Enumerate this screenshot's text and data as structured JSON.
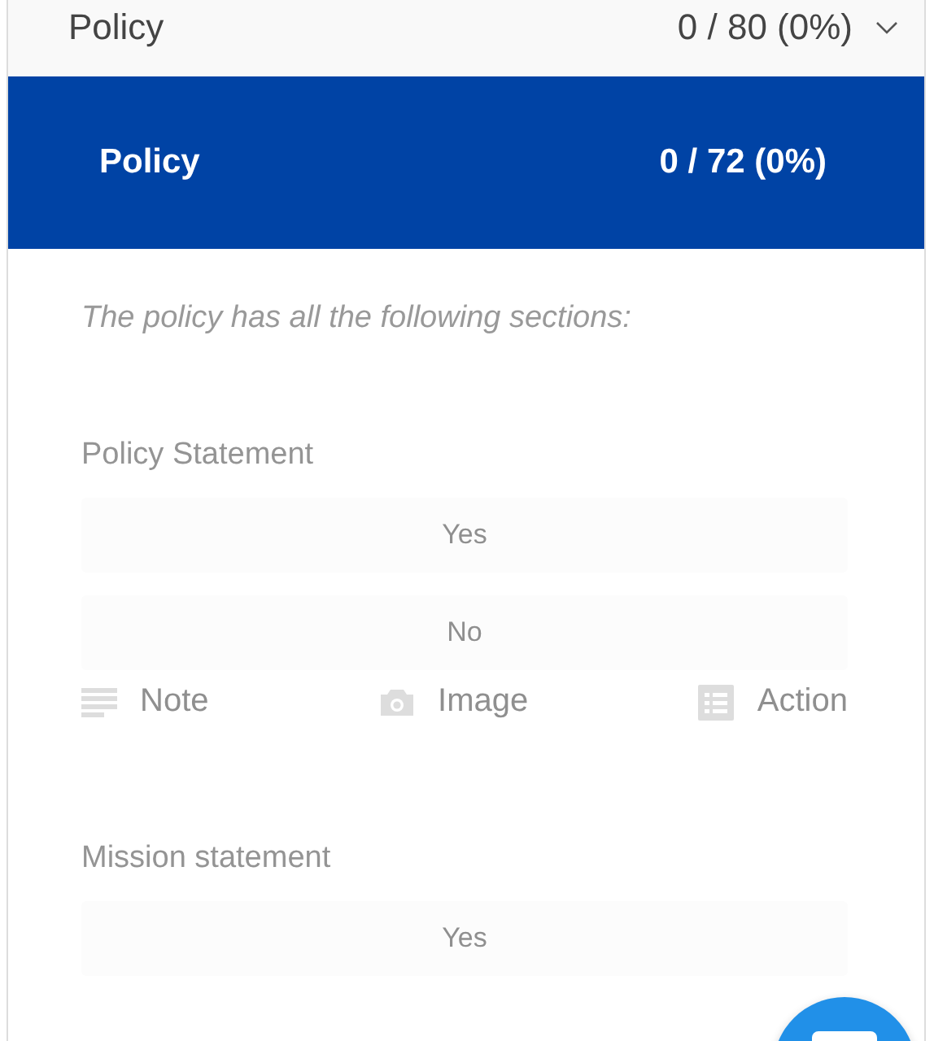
{
  "header": {
    "title": "Policy",
    "score": "0 / 80 (0%)",
    "expanded": true
  },
  "section": {
    "title": "Policy",
    "score": "0 / 72 (0%)"
  },
  "instruction": "The policy has all the following sections:",
  "questions": [
    {
      "label": "Policy Statement",
      "disabled": true,
      "options": [
        {
          "label": "Yes",
          "selected": false
        },
        {
          "label": "No",
          "selected": false
        }
      ],
      "actions": [
        {
          "kind": "note",
          "label": "Note"
        },
        {
          "kind": "image",
          "label": "Image"
        },
        {
          "kind": "action",
          "label": "Action"
        }
      ]
    },
    {
      "label": "Mission statement",
      "disabled": true,
      "options": [
        {
          "label": "Yes",
          "selected": false
        }
      ]
    }
  ]
}
